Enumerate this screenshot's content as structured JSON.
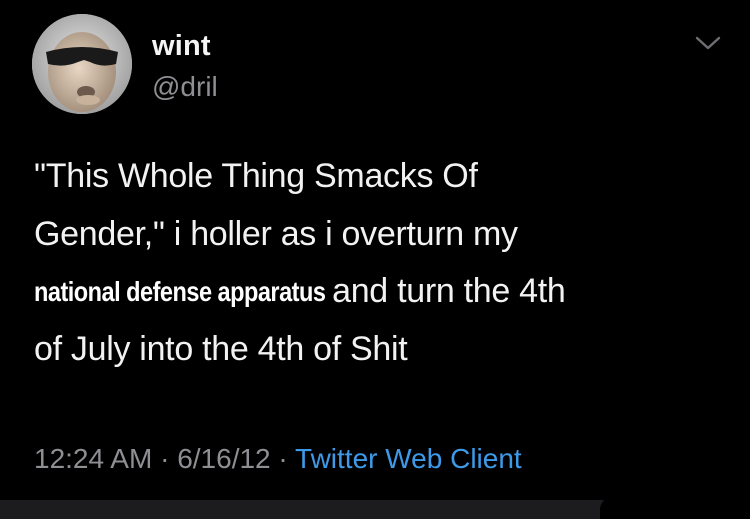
{
  "tweet": {
    "author": {
      "display_name": "wint",
      "handle": "@dril",
      "avatar_icon": "avatar-sunglasses-photo-icon"
    },
    "menu_icon": "chevron-down-icon",
    "text_lines": [
      "\"This Whole Thing Smacks Of",
      "Gender,\" i holler as i overturn my",
      "and turn the 4th",
      "of July into the 4th of Shit"
    ],
    "overlay_text": "national defense apparatus",
    "timestamp": "12:24 AM",
    "date": "6/16/12",
    "separator": "·",
    "client": "Twitter Web Client",
    "colors": {
      "background": "#000000",
      "text": "#f2f2f2",
      "secondary": "#8e8e93",
      "link": "#3e9ae8"
    }
  }
}
